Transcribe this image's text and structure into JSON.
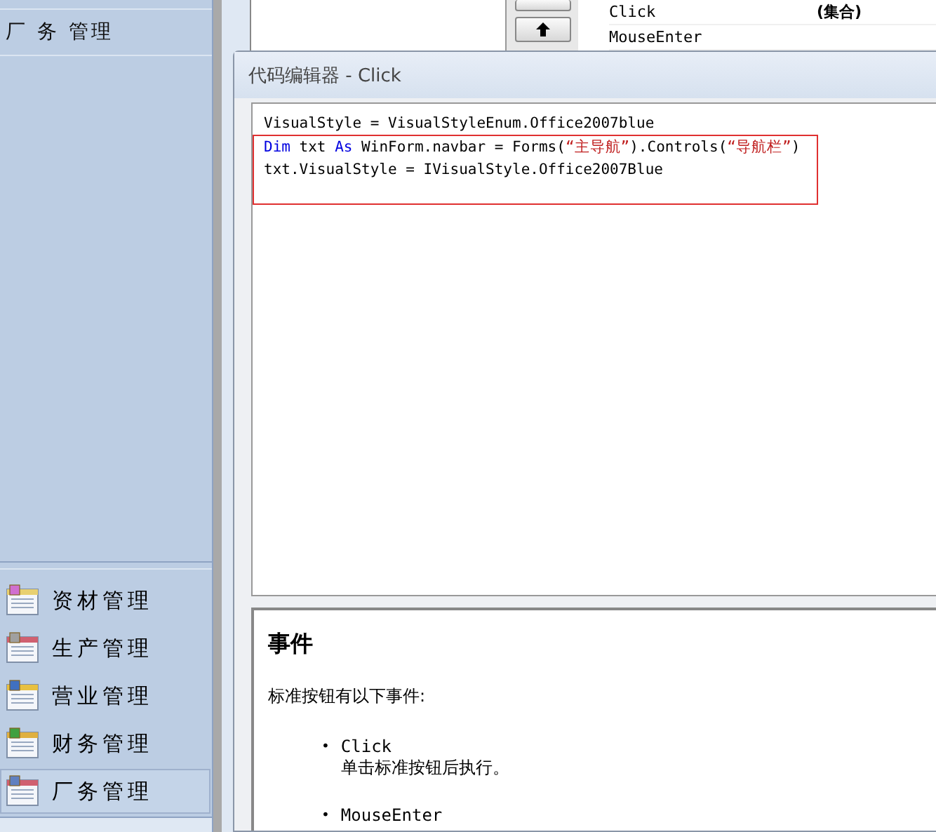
{
  "sidebar": {
    "header": "厂 务 管理",
    "items": [
      {
        "label": "资材管理",
        "selected": false
      },
      {
        "label": "生产管理",
        "selected": false
      },
      {
        "label": "营业管理",
        "selected": false
      },
      {
        "label": "财务管理",
        "selected": false
      },
      {
        "label": "厂务管理",
        "selected": true
      }
    ]
  },
  "property_list": {
    "rows": [
      {
        "name": "Click",
        "value": "(集合)"
      },
      {
        "name": "MouseEnter"
      }
    ]
  },
  "dialog": {
    "title": "代码编辑器 - Click",
    "code_lines": [
      {
        "marked": false,
        "tokens": [
          {
            "kind": "plain",
            "text": "VisualStyle = VisualStyleEnum.Office2007blue"
          }
        ]
      },
      {
        "marked": true,
        "tokens": [
          {
            "kind": "keyword",
            "text": "Dim"
          },
          {
            "kind": "plain",
            "text": " txt "
          },
          {
            "kind": "keyword",
            "text": "As"
          },
          {
            "kind": "plain",
            "text": " WinForm.navbar = Forms("
          },
          {
            "kind": "string",
            "text": "“主导航”"
          },
          {
            "kind": "plain",
            "text": ").Controls("
          },
          {
            "kind": "string",
            "text": "“导航栏”"
          },
          {
            "kind": "plain",
            "text": ")"
          }
        ]
      },
      {
        "marked": true,
        "tokens": [
          {
            "kind": "plain",
            "text": "txt.VisualStyle = IVisualStyle.Office2007Blue"
          }
        ]
      }
    ],
    "help": {
      "heading": "事件",
      "intro": "标准按钮有以下事件:",
      "events": [
        {
          "marker": "•",
          "name": "Click",
          "description": "单击标准按钮后执行。"
        },
        {
          "marker": "•",
          "name": "MouseEnter"
        }
      ]
    }
  }
}
